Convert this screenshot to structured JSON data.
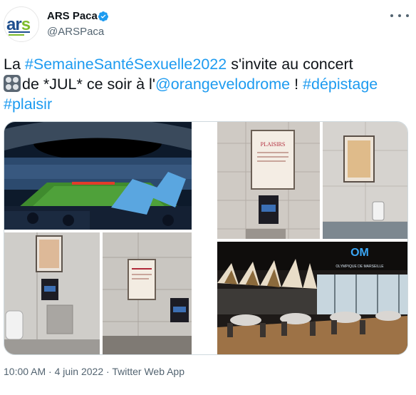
{
  "author": {
    "name": "ARS Paca",
    "handle": "@ARSPaca",
    "avatar_logo_text": "ars"
  },
  "tweet": {
    "word_la": "La",
    "hashtag_semaine": "#SemaineSantéSexuelle2022",
    "text_invite": " s'invite au concert",
    "text_jul": "de *JUL* ce soir à l'",
    "mention_velodrome": "@orangevelodrome",
    "text_bang": " ! ",
    "hashtag_depistage": "#dépistage",
    "hashtag_plaisir": "#plaisir"
  },
  "media": {
    "poster_title": "PLAISIRS",
    "om_sign": "OLYMPIQUE DE MARSEILLE"
  },
  "footer": {
    "time": "10:00 AM",
    "sep1": " · ",
    "date": "4 juin 2022",
    "sep2": " · ",
    "app": "Twitter Web App"
  },
  "colors": {
    "link": "#1d9bf0",
    "text": "#0f1419",
    "secondary": "#536471",
    "verified": "#1d9bf0"
  },
  "icons": [
    "verified-badge-icon",
    "more-options-icon",
    "dice-emoji-icon"
  ]
}
